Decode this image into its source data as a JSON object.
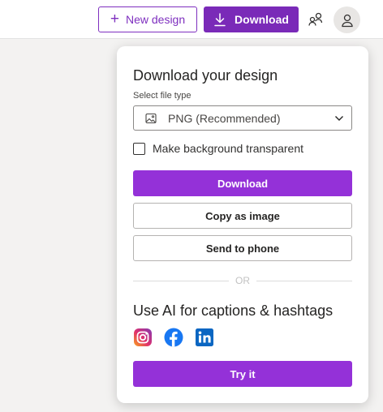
{
  "topbar": {
    "new_design_label": "New design",
    "download_label": "Download"
  },
  "panel": {
    "title": "Download your design",
    "file_type_label": "Select file type",
    "file_type_value": "PNG (Recommended)",
    "transparent_label": "Make background transparent",
    "transparent_checked": false,
    "download_label": "Download",
    "copy_label": "Copy as image",
    "send_label": "Send to phone",
    "or_label": "OR",
    "ai_title": "Use AI for captions & hashtags",
    "socials": [
      "instagram-icon",
      "facebook-icon",
      "linkedin-icon"
    ],
    "try_label": "Try it"
  },
  "colors": {
    "accent": "#7a2ab8",
    "primary_button": "#9431d8"
  }
}
